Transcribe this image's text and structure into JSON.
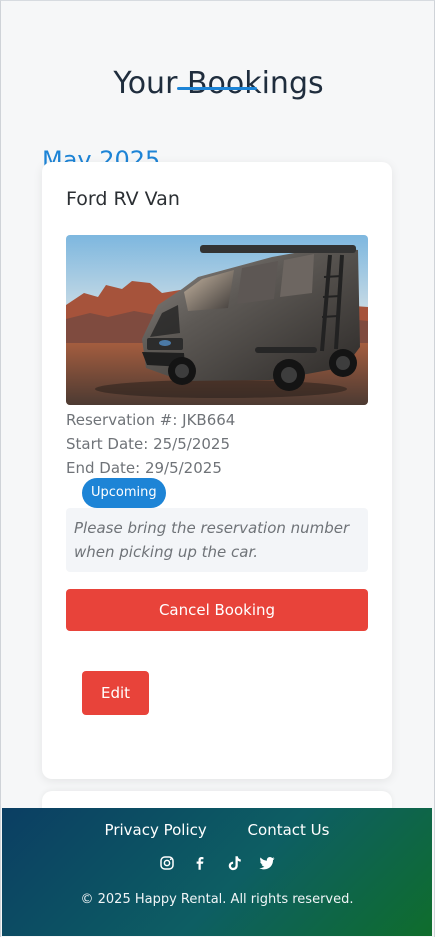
{
  "page": {
    "title": "Your Bookings"
  },
  "bookings": {
    "month_heading": "May 2025",
    "items": [
      {
        "vehicle_name": "Ford RV Van",
        "image_icon": "van-photo",
        "reservation_line": "Reservation #: JKB664",
        "start_line": "Start Date: 25/5/2025",
        "end_line": "End Date: 29/5/2025",
        "status": "Upcoming",
        "notice": "Please bring the reservation number when picking up the car.",
        "cancel_label": "Cancel Booking",
        "edit_label": "Edit"
      }
    ]
  },
  "footer": {
    "links": [
      {
        "label": "Privacy Policy"
      },
      {
        "label": "Contact Us"
      }
    ],
    "social_icons": [
      "instagram-icon",
      "facebook-icon",
      "tiktok-icon",
      "twitter-icon"
    ],
    "copyright": "© 2025 Happy Rental. All rights reserved."
  },
  "colors": {
    "accent": "#1d84d6",
    "danger": "#e8433a",
    "footer_start": "#0b3e63",
    "footer_end": "#0f6d2c",
    "page_background": "#f6f7f8"
  }
}
